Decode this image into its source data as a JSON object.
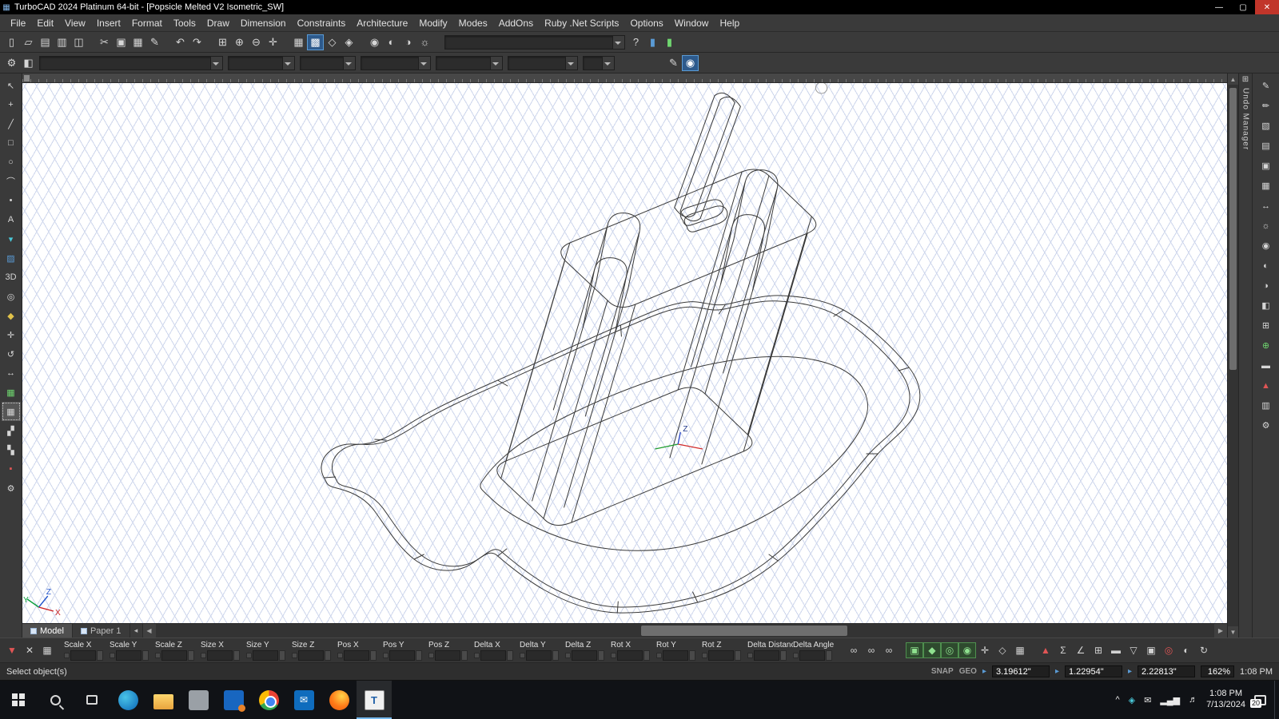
{
  "titlebar": {
    "title": "TurboCAD 2024 Platinum 64-bit - [Popsicle Melted V2 Isometric_SW]",
    "app_icon": "▦",
    "minimize": "—",
    "maximize": "▢",
    "close": "✕"
  },
  "menu": {
    "items": [
      {
        "name": "menu-file",
        "label": "File"
      },
      {
        "name": "menu-edit",
        "label": "Edit"
      },
      {
        "name": "menu-view",
        "label": "View"
      },
      {
        "name": "menu-insert",
        "label": "Insert"
      },
      {
        "name": "menu-format",
        "label": "Format"
      },
      {
        "name": "menu-tools",
        "label": "Tools"
      },
      {
        "name": "menu-draw",
        "label": "Draw"
      },
      {
        "name": "menu-dimension",
        "label": "Dimension"
      },
      {
        "name": "menu-constraints",
        "label": "Constraints"
      },
      {
        "name": "menu-architecture",
        "label": "Architecture"
      },
      {
        "name": "menu-modify",
        "label": "Modify"
      },
      {
        "name": "menu-modes",
        "label": "Modes"
      },
      {
        "name": "menu-addons",
        "label": "AddOns"
      },
      {
        "name": "menu-ruby-net-scripts",
        "label": "Ruby .Net Scripts"
      },
      {
        "name": "menu-options",
        "label": "Options"
      },
      {
        "name": "menu-window",
        "label": "Window"
      },
      {
        "name": "menu-help",
        "label": "Help"
      }
    ]
  },
  "toolbar1": {
    "icons": [
      {
        "name": "new-file-icon",
        "glyph": "▯"
      },
      {
        "name": "open-file-icon",
        "glyph": "▱"
      },
      {
        "name": "save-icon",
        "glyph": "▤"
      },
      {
        "name": "print-icon",
        "glyph": "▥"
      },
      {
        "name": "print-preview-icon",
        "glyph": "◫",
        "cls": "gap"
      },
      {
        "name": "cut-icon",
        "glyph": "✂"
      },
      {
        "name": "copy-icon",
        "glyph": "▣"
      },
      {
        "name": "paste-icon",
        "glyph": "▦"
      },
      {
        "name": "format-painter-icon",
        "glyph": "✎",
        "cls": "gap"
      },
      {
        "name": "undo-icon",
        "glyph": "↶"
      },
      {
        "name": "redo-icon",
        "glyph": "↷",
        "cls": "gap"
      },
      {
        "name": "zoom-window-icon",
        "glyph": "⊞"
      },
      {
        "name": "zoom-in-icon",
        "glyph": "⊕"
      },
      {
        "name": "zoom-out-icon",
        "glyph": "⊖"
      },
      {
        "name": "pan-icon",
        "glyph": "✛",
        "cls": "gap"
      },
      {
        "name": "grid-toggle-icon",
        "glyph": "▦"
      },
      {
        "name": "snap-grid-icon",
        "glyph": "▩",
        "cls": "active-blue"
      },
      {
        "name": "ortho-icon",
        "glyph": "◇"
      },
      {
        "name": "workplane-icon",
        "glyph": "◈",
        "cls": "gap"
      },
      {
        "name": "camera-icon",
        "glyph": "◉"
      },
      {
        "name": "render-mode-icon",
        "glyph": "◐"
      },
      {
        "name": "materials-icon",
        "glyph": "◑"
      },
      {
        "name": "lights-icon",
        "glyph": "☼",
        "cls": "gap"
      }
    ],
    "icons_right": [
      {
        "name": "help-pointer-icon",
        "glyph": "?"
      },
      {
        "name": "dock-left-icon",
        "glyph": "▮",
        "cls": "blue"
      },
      {
        "name": "dock-right-icon",
        "glyph": "▮",
        "cls": "green"
      }
    ]
  },
  "toolbar2": {
    "icons_left": [
      {
        "name": "property-gear-icon",
        "glyph": "⚙"
      },
      {
        "name": "style-manager-icon",
        "glyph": "◧"
      }
    ],
    "combos": [
      {
        "name": "selection-style-combo",
        "style": "width:230px"
      },
      {
        "name": "layer-combo",
        "style": "width:84px"
      },
      {
        "name": "pen-style-combo",
        "style": "width:70px"
      },
      {
        "name": "pen-width-combo",
        "style": "width:88px"
      },
      {
        "name": "pen-color-combo",
        "style": "width:84px"
      },
      {
        "name": "brush-style-combo",
        "style": "width:88px"
      },
      {
        "name": "text-style-combo",
        "style": "width:40px"
      }
    ],
    "icons_right": [
      {
        "name": "pen-tool-icon",
        "glyph": "✎"
      },
      {
        "name": "render-toggle-icon",
        "glyph": "◉",
        "cls": "active-blue"
      }
    ]
  },
  "left_palette": [
    {
      "name": "select-tool-icon",
      "glyph": "↖"
    },
    {
      "name": "pick-tool-icon",
      "glyph": "+"
    },
    {
      "name": "line-tool-icon",
      "glyph": "╱"
    },
    {
      "name": "rectangle-tool-icon",
      "glyph": "□"
    },
    {
      "name": "circle-tool-icon",
      "glyph": "○"
    },
    {
      "name": "arc-tool-icon",
      "glyph": "⌒"
    },
    {
      "name": "point-tool-icon",
      "glyph": "•"
    },
    {
      "name": "text-tool-icon",
      "glyph": "A"
    },
    {
      "name": "marker-tool-icon",
      "glyph": "▾",
      "cls": "teal"
    },
    {
      "name": "hatch-tool-icon",
      "glyph": "▨",
      "cls": "blue"
    },
    {
      "name": "mode-3d-icon",
      "glyph": "3D"
    },
    {
      "name": "sphere-tool-icon",
      "glyph": "◎"
    },
    {
      "name": "prism-tool-icon",
      "glyph": "◆",
      "cls": "yellow"
    },
    {
      "name": "move-tool-icon",
      "glyph": "✛"
    },
    {
      "name": "rotate-tool-icon",
      "glyph": "↺"
    },
    {
      "name": "scale-tool-icon",
      "glyph": "↔"
    },
    {
      "name": "snap-palette-icon",
      "glyph": "▦",
      "cls": "green"
    },
    {
      "name": "pattern-tool-icon",
      "glyph": "▦",
      "cls": "active"
    },
    {
      "name": "mirror-tool-icon",
      "glyph": "▞"
    },
    {
      "name": "array-tool-icon",
      "glyph": "▚"
    },
    {
      "name": "material-red-icon",
      "glyph": "▪",
      "cls": "red"
    },
    {
      "name": "palette-settings-icon",
      "glyph": "⚙"
    }
  ],
  "right_palette": [
    {
      "name": "edit-palette-icon",
      "glyph": "✎"
    },
    {
      "name": "pens-palette-icon",
      "glyph": "✏"
    },
    {
      "name": "brush-palette-icon",
      "glyph": "▧"
    },
    {
      "name": "layers-palette-icon",
      "glyph": "▤"
    },
    {
      "name": "blocks-palette-icon",
      "glyph": "▣"
    },
    {
      "name": "library-palette-icon",
      "glyph": "▦"
    },
    {
      "name": "measure-palette-icon",
      "glyph": "↔"
    },
    {
      "name": "lights-palette-icon",
      "glyph": "☼"
    },
    {
      "name": "camera-palette-icon",
      "glyph": "◉"
    },
    {
      "name": "materials-palette-icon",
      "glyph": "◐"
    },
    {
      "name": "render-palette-icon",
      "glyph": "◑"
    },
    {
      "name": "profile-palette-icon",
      "glyph": "◧"
    },
    {
      "name": "calculator-palette-icon",
      "glyph": "⊞"
    },
    {
      "name": "add-palette-icon",
      "glyph": "⊕",
      "cls": "green"
    },
    {
      "name": "ruler-palette-icon",
      "glyph": "▬"
    },
    {
      "name": "alert-palette-icon",
      "glyph": "▲",
      "cls": "red"
    },
    {
      "name": "database-palette-icon",
      "glyph": "▥"
    },
    {
      "name": "gear-palette-icon",
      "glyph": "⚙"
    }
  ],
  "right_panel": {
    "undo_label": "Undo Manager",
    "undo_icon": "⊞"
  },
  "sheet_tabs": [
    {
      "name": "tab-model",
      "label": "Model",
      "cls": "active"
    },
    {
      "name": "tab-paper-1",
      "label": "Paper 1"
    }
  ],
  "inspector": {
    "lead_icons": [
      {
        "name": "insp-selector-icon",
        "glyph": "▼",
        "cls": "red"
      },
      {
        "name": "insp-clear-icon",
        "glyph": "✕"
      },
      {
        "name": "insp-grid-icon",
        "glyph": "▦",
        "cls": "gap"
      }
    ],
    "fields": [
      {
        "name": "field-scale-x",
        "label": "Scale X"
      },
      {
        "name": "field-scale-y",
        "label": "Scale Y"
      },
      {
        "name": "field-scale-z",
        "label": "Scale Z"
      },
      {
        "name": "field-size-x",
        "label": "Size X"
      },
      {
        "name": "field-size-y",
        "label": "Size Y"
      },
      {
        "name": "field-size-z",
        "label": "Size Z"
      },
      {
        "name": "field-pos-x",
        "label": "Pos X"
      },
      {
        "name": "field-pos-y",
        "label": "Pos Y"
      },
      {
        "name": "field-pos-z",
        "label": "Pos Z"
      },
      {
        "name": "field-delta-x",
        "label": "Delta X"
      },
      {
        "name": "field-delta-y",
        "label": "Delta Y"
      },
      {
        "name": "field-delta-z",
        "label": "Delta Z"
      },
      {
        "name": "field-rot-x",
        "label": "Rot X"
      },
      {
        "name": "field-rot-y",
        "label": "Rot Y"
      },
      {
        "name": "field-rot-z",
        "label": "Rot Z"
      },
      {
        "name": "field-delta-distance",
        "label": "Delta Distance"
      },
      {
        "name": "field-delta-angle",
        "label": "Delta Angle"
      }
    ],
    "icons": [
      {
        "name": "link-x-icon",
        "glyph": "∞"
      },
      {
        "name": "link-y-icon",
        "glyph": "∞"
      },
      {
        "name": "link-z-icon",
        "glyph": "∞",
        "cls": "gap"
      },
      {
        "name": "snap-vertex-icon",
        "glyph": "▣",
        "cls": "green"
      },
      {
        "name": "snap-midpoint-icon",
        "glyph": "◆",
        "cls": "green"
      },
      {
        "name": "snap-center-icon",
        "glyph": "◎",
        "cls": "green"
      },
      {
        "name": "snap-quadrant-icon",
        "glyph": "◉",
        "cls": "green"
      },
      {
        "name": "snap-intersect-icon",
        "glyph": "✛"
      },
      {
        "name": "snap-nearest-icon",
        "glyph": "◇"
      },
      {
        "name": "snap-grid2-icon",
        "glyph": "▦",
        "cls": "gap"
      },
      {
        "name": "alert-icon",
        "glyph": "▲",
        "cls": "red"
      },
      {
        "name": "sum-icon",
        "glyph": "Σ"
      },
      {
        "name": "angle-icon",
        "glyph": "∠"
      },
      {
        "name": "table-icon",
        "glyph": "⊞"
      },
      {
        "name": "ruler-icon",
        "glyph": "▬"
      },
      {
        "name": "filter-icon",
        "glyph": "▽"
      },
      {
        "name": "lock-icon",
        "glyph": "▣"
      },
      {
        "name": "target-icon",
        "glyph": "◎",
        "cls": "red"
      },
      {
        "name": "world-icon",
        "glyph": "◐"
      },
      {
        "name": "refresh-icon",
        "glyph": "↻"
      }
    ]
  },
  "statusbar": {
    "prompt": "Select object(s)",
    "snap": "SNAP",
    "geo": "GEO",
    "coord_marker": "▸",
    "coords": [
      "3.19612\"",
      "1.22954\"",
      "2.22813\""
    ],
    "zoom": "162%",
    "time": "1:08 PM"
  },
  "taskbar": {
    "apps": [
      {
        "name": "app-edge",
        "cls": "ic-edge"
      },
      {
        "name": "app-file-explorer",
        "cls": "ic-folder"
      },
      {
        "name": "app-notes",
        "cls": "ic-gray"
      },
      {
        "name": "app-office",
        "cls": "ic-blue"
      },
      {
        "name": "app-chrome",
        "cls": "ic-chrome"
      },
      {
        "name": "app-outlook",
        "cls": "ic-outlook",
        "glyph": "✉"
      },
      {
        "name": "app-firefox",
        "cls": "ic-firefox"
      },
      {
        "name": "app-turbocad",
        "cls": "ic-tcad",
        "glyph": "T",
        "state": "active"
      }
    ],
    "tray_icons": [
      {
        "name": "tray-chevron-icon",
        "glyph": "^"
      },
      {
        "name": "tray-app-icon",
        "glyph": "◈",
        "cls": "teal"
      },
      {
        "name": "tray-mail-icon",
        "glyph": "✉"
      },
      {
        "name": "tray-network-icon",
        "glyph": "▂▄▆"
      },
      {
        "name": "tray-volume-icon",
        "glyph": "♬"
      }
    ],
    "time": "1:08 PM",
    "date": "7/13/2024",
    "badge": "20"
  }
}
